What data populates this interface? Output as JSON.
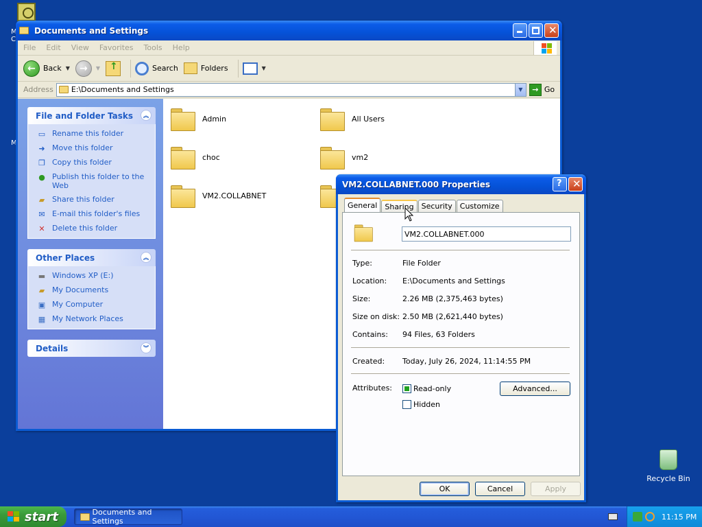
{
  "desktop": {
    "recycle_bin_label": "Recycle Bin",
    "edge_letters": [
      "M",
      "C",
      "M"
    ]
  },
  "explorer": {
    "title": "Documents and Settings",
    "menu": [
      "File",
      "Edit",
      "View",
      "Favorites",
      "Tools",
      "Help"
    ],
    "toolbar": {
      "back": "Back",
      "search": "Search",
      "folders": "Folders"
    },
    "address": {
      "label": "Address",
      "value": "E:\\Documents and Settings",
      "go": "Go"
    },
    "file_folder_tasks": {
      "title": "File and Folder Tasks",
      "items": [
        "Rename this folder",
        "Move this folder",
        "Copy this folder",
        "Publish this folder to the Web",
        "Share this folder",
        "E-mail this folder's files",
        "Delete this folder"
      ]
    },
    "other_places": {
      "title": "Other Places",
      "items": [
        "Windows XP (E:)",
        "My Documents",
        "My Computer",
        "My Network Places"
      ]
    },
    "details": {
      "title": "Details"
    },
    "folders": [
      "Admin",
      "All Users",
      "choc",
      "vm2",
      "VM2.COLLABNET"
    ]
  },
  "properties": {
    "title": "VM2.COLLABNET.000 Properties",
    "tabs": [
      "General",
      "Sharing",
      "Security",
      "Customize"
    ],
    "name": "VM2.COLLABNET.000",
    "rows": {
      "type_label": "Type:",
      "type_value": "File Folder",
      "location_label": "Location:",
      "location_value": "E:\\Documents and Settings",
      "size_label": "Size:",
      "size_value": "2.26 MB (2,375,463 bytes)",
      "size_on_disk_label": "Size on disk:",
      "size_on_disk_value": "2.50 MB (2,621,440 bytes)",
      "contains_label": "Contains:",
      "contains_value": "94 Files, 63 Folders",
      "created_label": "Created:",
      "created_value": "Today, July 26, 2024, 11:14:55 PM",
      "attributes_label": "Attributes:"
    },
    "attributes": {
      "read_only": "Read-only",
      "hidden": "Hidden",
      "advanced": "Advanced..."
    },
    "buttons": {
      "ok": "OK",
      "cancel": "Cancel",
      "apply": "Apply"
    }
  },
  "taskbar": {
    "start": "start",
    "task_button": "Documents and Settings",
    "clock": "11:15 PM"
  },
  "colors": {
    "desktop": "#0b3f9c",
    "titlebar": "#0552d8",
    "task_link": "#215dc6",
    "start_green": "#3a9a3a",
    "tray_blue": "#0f8ad8"
  }
}
